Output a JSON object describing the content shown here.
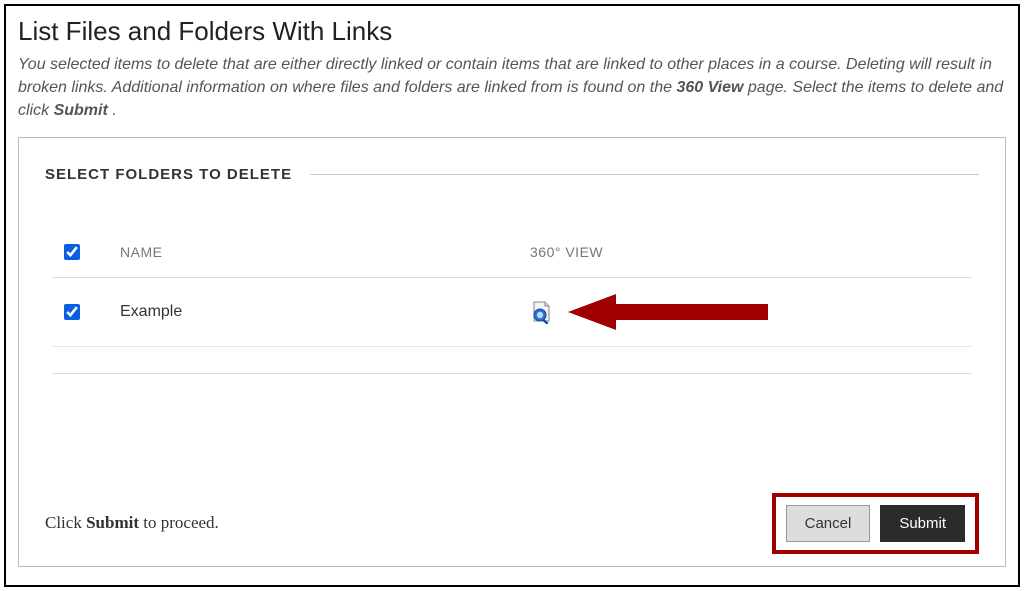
{
  "page": {
    "title": "List Files and Folders With Links",
    "description_pre": "You selected items to delete that are either directly linked or contain items that are linked to other places in a course. Deleting will result in broken links. Additional information on where files and folders are linked from is found on the ",
    "description_bold1": "360 View",
    "description_mid": " page. Select the items to delete and click ",
    "description_bold2": "Submit",
    "description_post": "."
  },
  "section": {
    "title": "SELECT FOLDERS TO DELETE"
  },
  "table": {
    "columns": {
      "name": "NAME",
      "view": "360° VIEW"
    },
    "rows": [
      {
        "name": "Example",
        "checked": true
      }
    ],
    "header_checked": true
  },
  "footer": {
    "prompt_pre": "Click ",
    "prompt_bold": "Submit",
    "prompt_post": " to proceed.",
    "cancel": "Cancel",
    "submit": "Submit"
  },
  "annotation": {
    "arrow_color": "#a00000"
  }
}
